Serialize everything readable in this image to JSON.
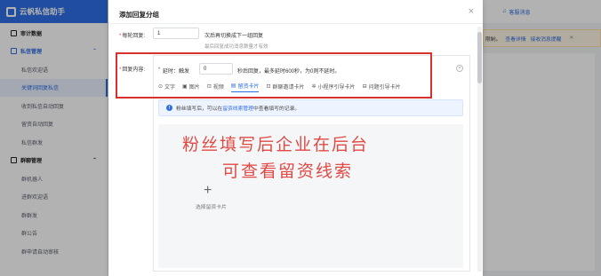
{
  "sidebar": {
    "app_title": "云帆私信助手",
    "items": [
      {
        "label": "审计数据",
        "kind": "group",
        "icon": "grid-icon"
      },
      {
        "label": "私信管理",
        "kind": "group-blue",
        "icon": "message-icon"
      },
      {
        "label": "私信欢迎语",
        "kind": "sub"
      },
      {
        "label": "关键词回复私信",
        "kind": "active"
      },
      {
        "label": "收到私信自动回复",
        "kind": "sub"
      },
      {
        "label": "留资自动回复",
        "kind": "sub"
      },
      {
        "label": "私信群发",
        "kind": "sub"
      },
      {
        "label": "群聊管理",
        "kind": "group",
        "icon": "group-icon"
      },
      {
        "label": "群机器人",
        "kind": "sub"
      },
      {
        "label": "进群欢迎语",
        "kind": "sub"
      },
      {
        "label": "群群发",
        "kind": "sub"
      },
      {
        "label": "群公告",
        "kind": "sub"
      },
      {
        "label": "群申请自动审核",
        "kind": "sub"
      }
    ]
  },
  "topbar": {
    "message": "客服消息"
  },
  "notice": {
    "text1": "限制。",
    "link1": "查看详情",
    "link2": "接收消息提醒",
    "close": "✕"
  },
  "dialog": {
    "title": "添加回复分组",
    "close": "×",
    "rounds_label": "每轮回复:",
    "rounds_value": "1",
    "rounds_suffix": "次后再切换成下一组回复",
    "rounds_hint": "最后回复成功消息数量才有效",
    "content_label": "回复内容:",
    "delay_prefix": "延时：触发",
    "delay_value": "0",
    "delay_suffix": "秒后回复，最多延时600秒，为0则不延时。",
    "tabs": [
      {
        "label": "文字",
        "icon": "⊙"
      },
      {
        "label": "图片",
        "icon": "▣"
      },
      {
        "label": "视频",
        "icon": "⊡"
      },
      {
        "label": "留资卡片",
        "icon": "▤",
        "active": true
      },
      {
        "label": "群聊邀请卡片",
        "icon": "⊡"
      },
      {
        "label": "小程序引导卡片",
        "icon": "✲"
      },
      {
        "label": "问题引导卡片",
        "icon": "⊟"
      }
    ],
    "info_text_a": "粉丝填写后，可以在",
    "info_link": "留资线索管理",
    "info_text_b": "中查看填写的记录。",
    "plus": "+",
    "choose_card": "选择留资卡片"
  },
  "caption": {
    "line1": "粉丝填写后企业在后台",
    "line2": "可查看留资线索"
  },
  "colors": {
    "accent": "#2f6fe4",
    "highlight": "#d6322b",
    "caption": "#e14a44"
  }
}
